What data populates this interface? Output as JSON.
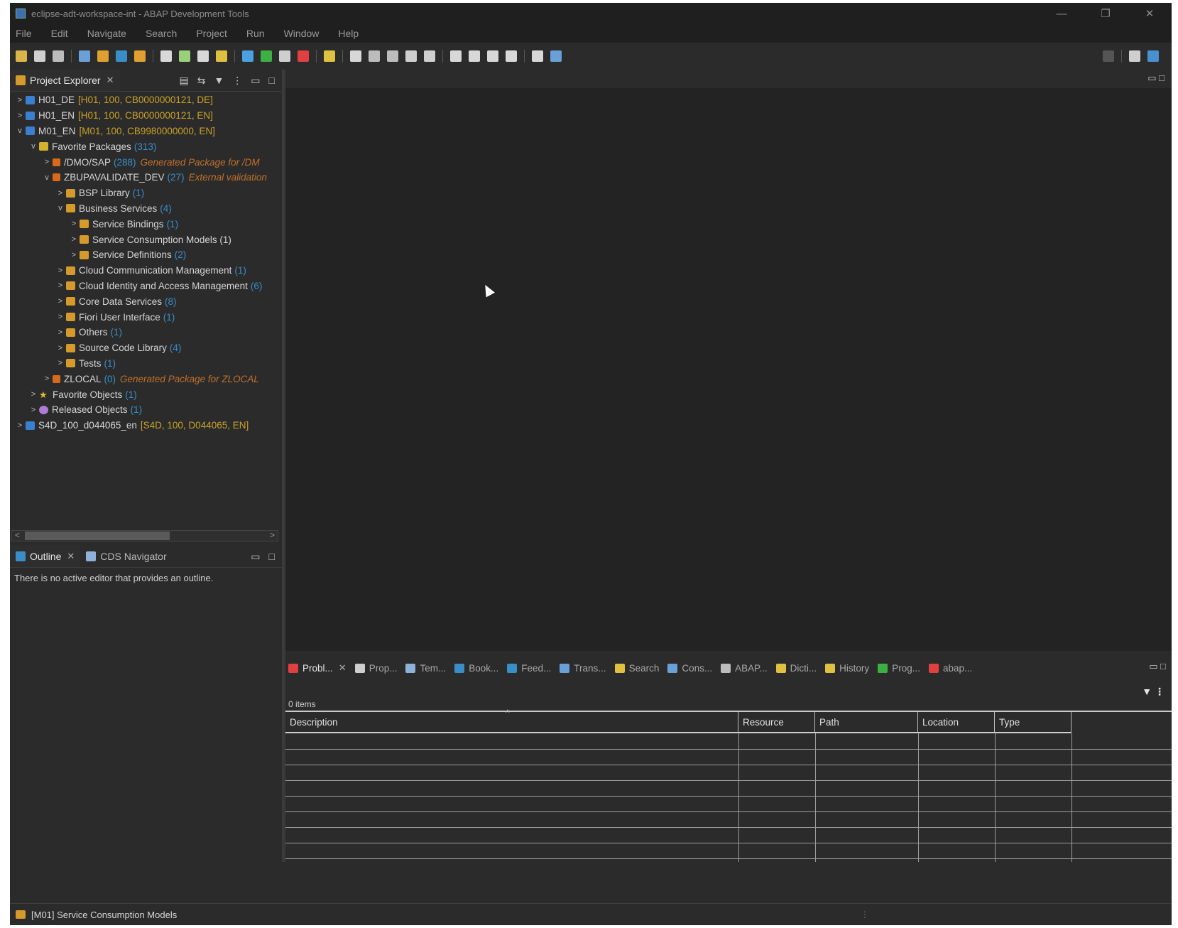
{
  "window": {
    "title": "eclipse-adt-workspace-int - ABAP Development Tools",
    "controls": [
      "—",
      "❐",
      "✕"
    ]
  },
  "menu": [
    "File",
    "Edit",
    "Navigate",
    "Search",
    "Project",
    "Run",
    "Window",
    "Help"
  ],
  "project_explorer": {
    "title": "Project Explorer",
    "tree": [
      {
        "level": 0,
        "twisty": ">",
        "icon": "project-icon",
        "label": "H01_DE",
        "meta": "[H01, 100, CB0000000121, DE]"
      },
      {
        "level": 0,
        "twisty": ">",
        "icon": "project-icon",
        "label": "H01_EN",
        "meta": "[H01, 100, CB0000000121, EN]"
      },
      {
        "level": 0,
        "twisty": "v",
        "icon": "project-icon",
        "label": "M01_EN",
        "meta": "[M01, 100, CB9980000000, EN]"
      },
      {
        "level": 1,
        "twisty": "v",
        "icon": "favorite-packages-icon",
        "label": "Favorite Packages",
        "count": "(313)"
      },
      {
        "level": 2,
        "twisty": ">",
        "icon": "package-icon",
        "label": "/DMO/SAP",
        "count": "(288)",
        "comment": "Generated Package for /DM"
      },
      {
        "level": 2,
        "twisty": "v",
        "icon": "package-icon",
        "label": "ZBUPAVALIDATE_DEV",
        "count": "(27)",
        "comment": "External validation"
      },
      {
        "level": 3,
        "twisty": ">",
        "icon": "folder-icon",
        "label": "BSP Library",
        "count": "(1)"
      },
      {
        "level": 3,
        "twisty": "v",
        "icon": "folder-icon",
        "label": "Business Services",
        "count": "(4)"
      },
      {
        "level": 4,
        "twisty": ">",
        "icon": "folder-icon",
        "label": "Service Bindings",
        "count": "(1)"
      },
      {
        "level": 4,
        "twisty": ">",
        "icon": "folder-icon",
        "label": "Service Consumption Models (1)",
        "count": ""
      },
      {
        "level": 4,
        "twisty": ">",
        "icon": "folder-icon",
        "label": "Service Definitions",
        "count": "(2)"
      },
      {
        "level": 3,
        "twisty": ">",
        "icon": "folder-icon",
        "label": "Cloud Communication Management",
        "count": "(1)"
      },
      {
        "level": 3,
        "twisty": ">",
        "icon": "folder-icon",
        "label": "Cloud Identity and Access Management",
        "count": "(6)"
      },
      {
        "level": 3,
        "twisty": ">",
        "icon": "folder-icon",
        "label": "Core Data Services",
        "count": "(8)"
      },
      {
        "level": 3,
        "twisty": ">",
        "icon": "folder-icon",
        "label": "Fiori User Interface",
        "count": "(1)"
      },
      {
        "level": 3,
        "twisty": ">",
        "icon": "folder-icon",
        "label": "Others",
        "count": "(1)"
      },
      {
        "level": 3,
        "twisty": ">",
        "icon": "folder-icon",
        "label": "Source Code Library",
        "count": "(4)"
      },
      {
        "level": 3,
        "twisty": ">",
        "icon": "folder-icon",
        "label": "Tests",
        "count": "(1)"
      },
      {
        "level": 2,
        "twisty": ">",
        "icon": "package-icon",
        "label": "ZLOCAL",
        "count": "(0)",
        "comment": "Generated Package for ZLOCAL"
      },
      {
        "level": 1,
        "twisty": ">",
        "icon": "star-icon",
        "label": "Favorite Objects",
        "count": "(1)"
      },
      {
        "level": 1,
        "twisty": ">",
        "icon": "gear-icon",
        "label": "Released Objects",
        "count": "(1)"
      },
      {
        "level": 0,
        "twisty": ">",
        "icon": "project-icon",
        "label": "S4D_100_d044065_en",
        "meta": "[S4D, 100, D044065, EN]"
      }
    ]
  },
  "outline": {
    "tabs": [
      "Outline",
      "CDS Navigator"
    ],
    "message": "There is no active editor that provides an outline."
  },
  "bottom_views": {
    "tabs": [
      "Probl...",
      "Prop...",
      "Tem...",
      "Book...",
      "Feed...",
      "Trans...",
      "Search",
      "Cons...",
      "ABAP...",
      "Dicti...",
      "History",
      "Prog...",
      "abap..."
    ],
    "items_count": "0 items",
    "columns": [
      "Description",
      "Resource",
      "Path",
      "Location",
      "Type"
    ]
  },
  "status": {
    "text": "[M01] Service Consumption Models"
  },
  "colors": {
    "background": "#2b2b2b",
    "editor": "#232323",
    "count": "#3a8ec8",
    "comment": "#c0702c",
    "meta": "#c9a227"
  }
}
